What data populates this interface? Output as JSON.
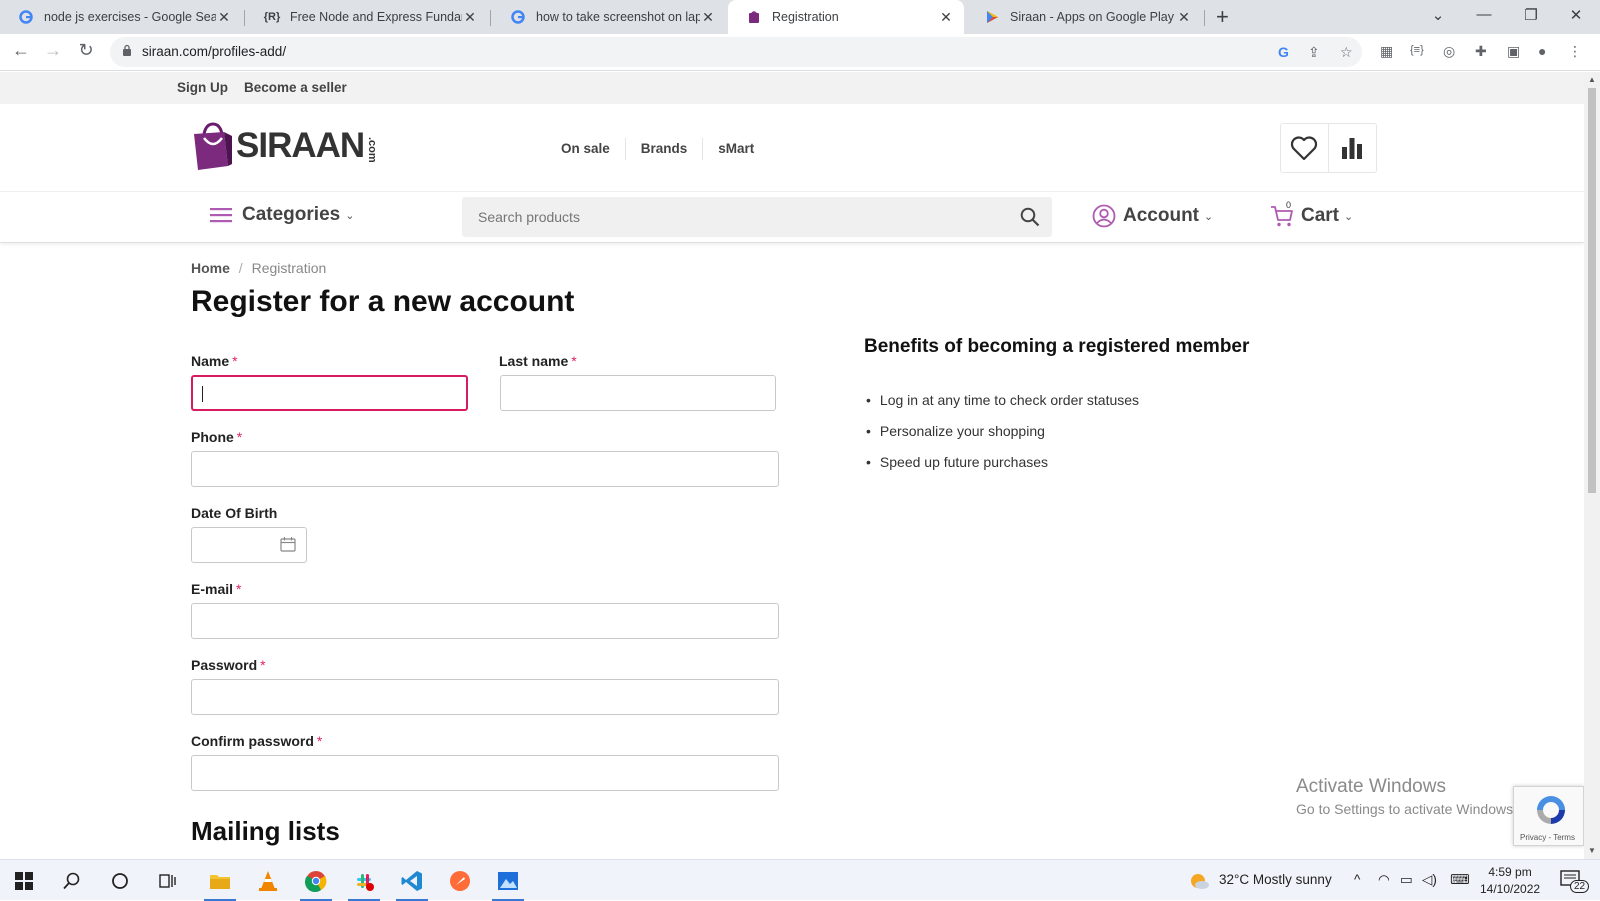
{
  "browser": {
    "tabs": [
      {
        "title": "node js exercises - Google Search",
        "favicon": "google-icon"
      },
      {
        "title": "Free Node and Express Fundamentals",
        "favicon": "r-brace-icon"
      },
      {
        "title": "how to take screenshot on laptop",
        "favicon": "google-icon"
      },
      {
        "title": "Registration",
        "favicon": "siraan-icon",
        "active": true
      },
      {
        "title": "Siraan - Apps on Google Play",
        "favicon": "google-play-icon"
      }
    ],
    "url": "siraan.com/profiles-add/"
  },
  "site": {
    "topbar": {
      "signup": "Sign Up",
      "seller": "Become a seller"
    },
    "logo": {
      "brand": "SIRAAN",
      "suffix": ".com"
    },
    "nav": [
      "On sale",
      "Brands",
      "sMart"
    ],
    "categories": "Categories",
    "search_placeholder": "Search products",
    "account": "Account",
    "cart": "Cart",
    "cart_count": "0",
    "accent": "#d81b60",
    "brand_color": "#6a1b6e"
  },
  "breadcrumb": {
    "home": "Home",
    "sep": "/",
    "current": "Registration"
  },
  "form": {
    "title": "Register for a new account",
    "name_label": "Name",
    "lastname_label": "Last name",
    "phone_label": "Phone",
    "dob_label": "Date Of Birth",
    "email_label": "E-mail",
    "password_label": "Password",
    "confirm_label": "Confirm password",
    "required_mark": "*",
    "mailing_title": "Mailing lists"
  },
  "benefits": {
    "title": "Benefits of becoming a registered member",
    "items": [
      "Log in at any time to check order statuses",
      "Personalize your shopping",
      "Speed up future purchases"
    ]
  },
  "overlay": {
    "activate_title": "Activate Windows",
    "activate_sub": "Go to Settings to activate Windows.",
    "recaptcha_terms": "Privacy - Terms"
  },
  "taskbar": {
    "weather": "32°C  Mostly sunny",
    "time": "4:59 pm",
    "date": "14/10/2022",
    "notifications": "22"
  }
}
